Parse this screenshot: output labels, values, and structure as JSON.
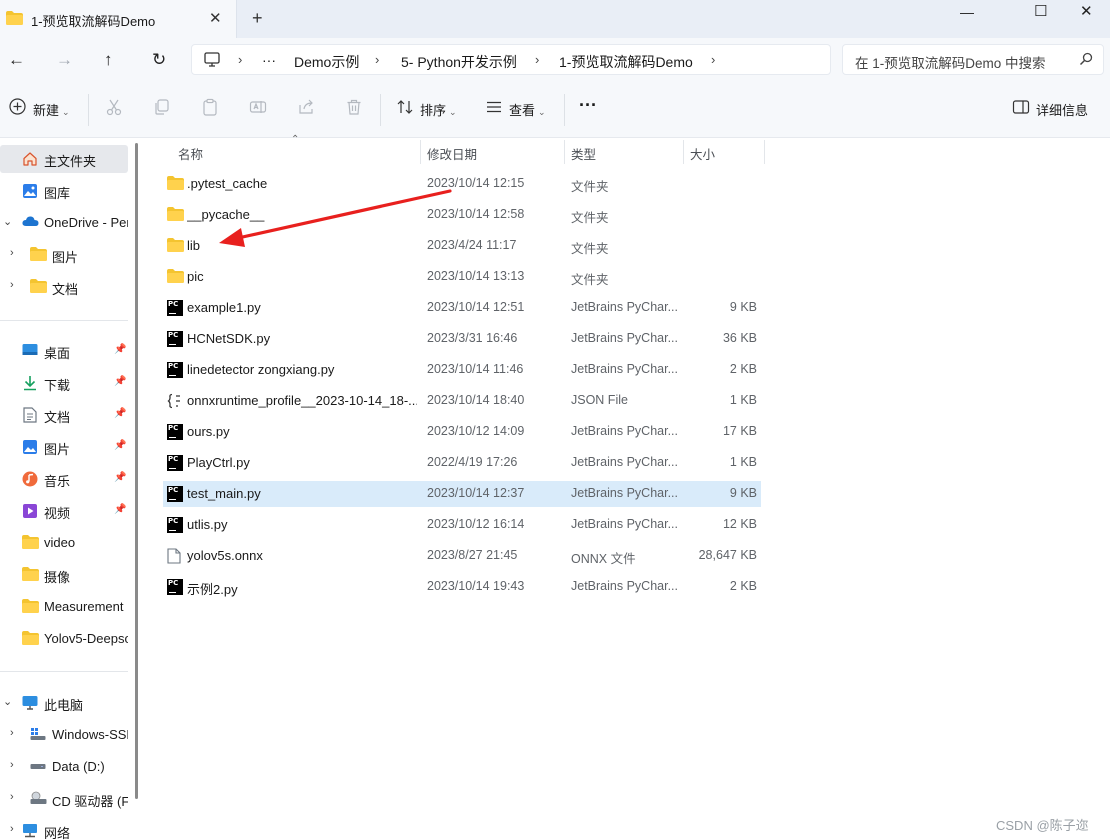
{
  "tab": {
    "title": "1-预览取流解码Demo",
    "close_glyph": "✕",
    "new_glyph": "+"
  },
  "window": {
    "minimize": "—",
    "maximize": "☐",
    "close": "✕"
  },
  "nav": {
    "back": "←",
    "forward": "→",
    "up": "↑",
    "refresh": "↻"
  },
  "address": {
    "more": "···",
    "sep": "›",
    "crumbs": [
      "Demo示例",
      "5- Python开发示例",
      "1-预览取流解码Demo"
    ]
  },
  "search": {
    "placeholder": "在 1-预览取流解码Demo 中搜索"
  },
  "toolbar": {
    "new_label": "新建",
    "sort_label": "排序",
    "view_label": "查看",
    "more_label": "···",
    "details_label": "详细信息"
  },
  "sidebar": {
    "items": [
      {
        "label": "主文件夹",
        "icon": "home-icon"
      },
      {
        "label": "图库",
        "icon": "gallery-icon"
      },
      {
        "label": "OneDrive - Per",
        "icon": "cloud-icon"
      },
      {
        "label": "图片",
        "icon": "folder-icon"
      },
      {
        "label": "文档",
        "icon": "folder-icon"
      },
      {
        "label": "桌面",
        "icon": "desktop-icon"
      },
      {
        "label": "下载",
        "icon": "download-icon"
      },
      {
        "label": "文档",
        "icon": "document-icon"
      },
      {
        "label": "图片",
        "icon": "picture-icon"
      },
      {
        "label": "音乐",
        "icon": "music-icon"
      },
      {
        "label": "视频",
        "icon": "video-icon"
      },
      {
        "label": "video",
        "icon": "folder-icon"
      },
      {
        "label": "摄像",
        "icon": "folder-icon"
      },
      {
        "label": "Measurement",
        "icon": "folder-icon"
      },
      {
        "label": "Yolov5-Deepso",
        "icon": "folder-icon"
      },
      {
        "label": "此电脑",
        "icon": "computer-icon"
      },
      {
        "label": "Windows-SSD",
        "icon": "drive-icon"
      },
      {
        "label": "Data (D:)",
        "icon": "drive-icon"
      },
      {
        "label": "CD 驱动器 (F:)",
        "icon": "cd-drive-icon"
      },
      {
        "label": "网络",
        "icon": "network-icon"
      }
    ]
  },
  "columns": {
    "name": "名称",
    "date": "修改日期",
    "type": "类型",
    "size": "大小"
  },
  "files": [
    {
      "name": ".pytest_cache",
      "date": "2023/10/14 12:15",
      "type": "文件夹",
      "size": "",
      "icon": "folder-icon"
    },
    {
      "name": "__pycache__",
      "date": "2023/10/14 12:58",
      "type": "文件夹",
      "size": "",
      "icon": "folder-icon"
    },
    {
      "name": "lib",
      "date": "2023/4/24 11:17",
      "type": "文件夹",
      "size": "",
      "icon": "folder-icon"
    },
    {
      "name": "pic",
      "date": "2023/10/14 13:13",
      "type": "文件夹",
      "size": "",
      "icon": "folder-icon"
    },
    {
      "name": "example1.py",
      "date": "2023/10/14 12:51",
      "type": "JetBrains PyChar...",
      "size": "9 KB",
      "icon": "pycharm-file-icon"
    },
    {
      "name": "HCNetSDK.py",
      "date": "2023/3/31 16:46",
      "type": "JetBrains PyChar...",
      "size": "36 KB",
      "icon": "pycharm-file-icon"
    },
    {
      "name": "linedetector  zongxiang.py",
      "date": "2023/10/14 11:46",
      "type": "JetBrains PyChar...",
      "size": "2 KB",
      "icon": "pycharm-file-icon"
    },
    {
      "name": "onnxruntime_profile__2023-10-14_18-...",
      "date": "2023/10/14 18:40",
      "type": "JSON File",
      "size": "1 KB",
      "icon": "json-file-icon"
    },
    {
      "name": "ours.py",
      "date": "2023/10/12 14:09",
      "type": "JetBrains PyChar...",
      "size": "17 KB",
      "icon": "pycharm-file-icon"
    },
    {
      "name": "PlayCtrl.py",
      "date": "2022/4/19 17:26",
      "type": "JetBrains PyChar...",
      "size": "1 KB",
      "icon": "pycharm-file-icon"
    },
    {
      "name": "test_main.py",
      "date": "2023/10/14 12:37",
      "type": "JetBrains PyChar...",
      "size": "9 KB",
      "icon": "pycharm-file-icon",
      "selected": true
    },
    {
      "name": "utlis.py",
      "date": "2023/10/12 16:14",
      "type": "JetBrains PyChar...",
      "size": "12 KB",
      "icon": "pycharm-file-icon"
    },
    {
      "name": "yolov5s.onnx",
      "date": "2023/8/27 21:45",
      "type": "ONNX 文件",
      "size": "28,647 KB",
      "icon": "blank-file-icon"
    },
    {
      "name": "示例2.py",
      "date": "2023/10/14 19:43",
      "type": "JetBrains PyChar...",
      "size": "2 KB",
      "icon": "pycharm-file-icon"
    }
  ],
  "watermark": "CSDN @陈子迩",
  "colors": {
    "folder": "#f4c430",
    "selection": "#d9ebfa",
    "annotation_arrow": "#e8201e",
    "onedrive": "#1d74d0"
  }
}
